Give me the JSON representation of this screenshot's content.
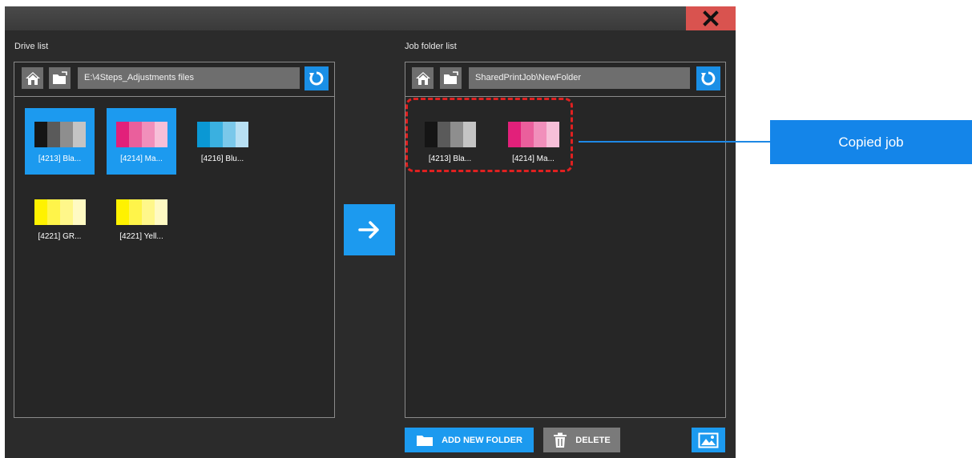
{
  "dialog": {
    "close_icon": "close-x-icon"
  },
  "drive_panel": {
    "label": "Drive list",
    "path": "E:\\4Steps_Adjustments files",
    "items": [
      {
        "label": "[4213] Bla...",
        "selected": true,
        "colors": [
          "#151515",
          "#5a5a5a",
          "#8e8e8e",
          "#c4c4c4"
        ]
      },
      {
        "label": "[4214] Ma...",
        "selected": true,
        "colors": [
          "#e2207a",
          "#ea5f9c",
          "#f18fbb",
          "#f7bfd8"
        ]
      },
      {
        "label": "[4216] Blu...",
        "selected": false,
        "colors": [
          "#0a98d4",
          "#3ab0e0",
          "#7ac8ea",
          "#b8e0f3"
        ]
      },
      {
        "label": "[4221] GR...",
        "selected": false,
        "colors": [
          "#fff200",
          "#fff44a",
          "#fff78a",
          "#fffac3"
        ]
      },
      {
        "label": "[4221] Yell...",
        "selected": false,
        "colors": [
          "#fff200",
          "#fff44a",
          "#fff78a",
          "#fffac3"
        ]
      }
    ]
  },
  "job_panel": {
    "label": "Job folder list",
    "path": "SharedPrintJob\\NewFolder",
    "items": [
      {
        "label": "[4213] Bla...",
        "selected": false,
        "colors": [
          "#151515",
          "#5a5a5a",
          "#8e8e8e",
          "#c4c4c4"
        ]
      },
      {
        "label": "[4214] Ma...",
        "selected": false,
        "colors": [
          "#e2207a",
          "#ea5f9c",
          "#f18fbb",
          "#f7bfd8"
        ]
      }
    ]
  },
  "buttons": {
    "add_new_folder": "ADD NEW FOLDER",
    "delete": "DELETE"
  },
  "annotation": {
    "callout_text": "Copied job",
    "highlight_color": "#e02020",
    "callout_color": "#1485e9"
  },
  "colors": {
    "accent": "#1c9aef",
    "dialog_bg": "#2b2b2b",
    "close_bg": "#d9534f"
  }
}
